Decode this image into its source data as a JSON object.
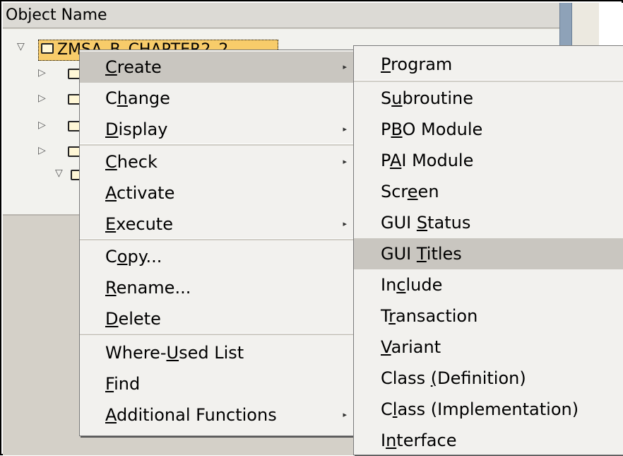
{
  "tree": {
    "header": "Object Name",
    "selected_item": "ZMSA_B_CHAPTER2_2"
  },
  "context_menu": {
    "items": [
      {
        "pre": "",
        "ul": "C",
        "post": "reate",
        "submenu": true
      },
      {
        "pre": "C",
        "ul": "h",
        "post": "ange",
        "submenu": false
      },
      {
        "pre": "",
        "ul": "D",
        "post": "isplay",
        "submenu": true
      },
      {
        "pre": "",
        "ul": "C",
        "post": "heck",
        "submenu": true
      },
      {
        "pre": "",
        "ul": "A",
        "post": "ctivate",
        "submenu": false
      },
      {
        "pre": "",
        "ul": "E",
        "post": "xecute",
        "submenu": true
      },
      {
        "pre": "C",
        "ul": "o",
        "post": "py...",
        "submenu": false
      },
      {
        "pre": "",
        "ul": "R",
        "post": "ename...",
        "submenu": false
      },
      {
        "pre": "",
        "ul": "D",
        "post": "elete",
        "submenu": false
      },
      {
        "pre": "Where-",
        "ul": "U",
        "post": "sed List",
        "submenu": false
      },
      {
        "pre": "",
        "ul": "F",
        "post": "ind",
        "submenu": false
      },
      {
        "pre": "",
        "ul": "A",
        "post": "dditional Functions",
        "submenu": true
      }
    ],
    "arrow_glyph": "▸"
  },
  "create_submenu": {
    "items": [
      {
        "pre": "",
        "ul": "P",
        "post": "rogram"
      },
      {
        "pre": "S",
        "ul": "u",
        "post": "broutine"
      },
      {
        "pre": "P",
        "ul": "B",
        "post": "O Module"
      },
      {
        "pre": "P",
        "ul": "A",
        "post": "I Module"
      },
      {
        "pre": "Scr",
        "ul": "e",
        "post": "en"
      },
      {
        "pre": "GUI ",
        "ul": "S",
        "post": "tatus"
      },
      {
        "pre": "GUI ",
        "ul": "T",
        "post": "itles"
      },
      {
        "pre": "In",
        "ul": "c",
        "post": "lude"
      },
      {
        "pre": "T",
        "ul": "r",
        "post": "ansaction"
      },
      {
        "pre": "",
        "ul": "V",
        "post": "ariant"
      },
      {
        "pre": "Class ",
        "ul": "(",
        "post": "Definition)"
      },
      {
        "pre": "C",
        "ul": "l",
        "post": "ass (Implementation)"
      },
      {
        "pre": "I",
        "ul": "n",
        "post": "terface"
      }
    ],
    "highlighted_index": 6
  },
  "colors": {
    "selection": "#f8cc6a",
    "menu_bg": "#f2f1ee",
    "highlight": "#c9c6c0"
  }
}
